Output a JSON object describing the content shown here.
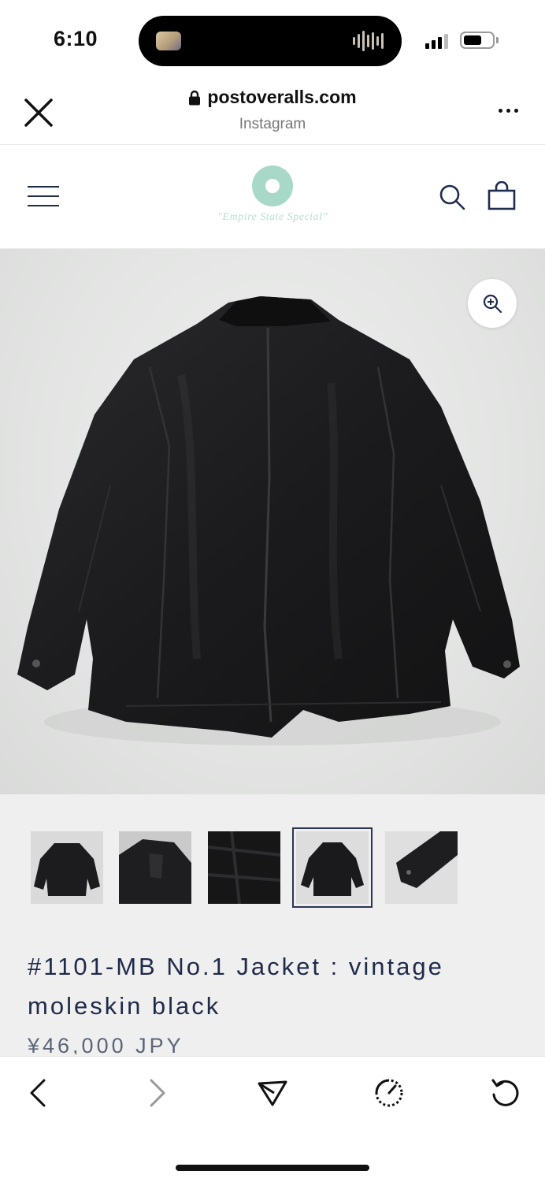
{
  "status_bar": {
    "time": "6:10"
  },
  "browser": {
    "url": "postoveralls.com",
    "source_label": "Instagram",
    "icons": [
      "close-icon",
      "lock-icon",
      "more-icon"
    ]
  },
  "site_header": {
    "logo_tagline": "\"Empire State Special\"",
    "icons": [
      "menu-icon",
      "search-icon",
      "shopping-bag-icon"
    ],
    "logo_color": "#a8d8c8"
  },
  "product": {
    "title": "#1101-MB No.1 Jacket : vintage moleskin black",
    "price": "¥46,000 JPY",
    "thumbnail_count": 5,
    "active_thumbnail": 4,
    "title_color": "#1e2a4a"
  },
  "toolbar": {
    "icons": [
      "back-icon",
      "forward-icon",
      "share-icon",
      "speedometer-icon",
      "reload-icon"
    ]
  }
}
